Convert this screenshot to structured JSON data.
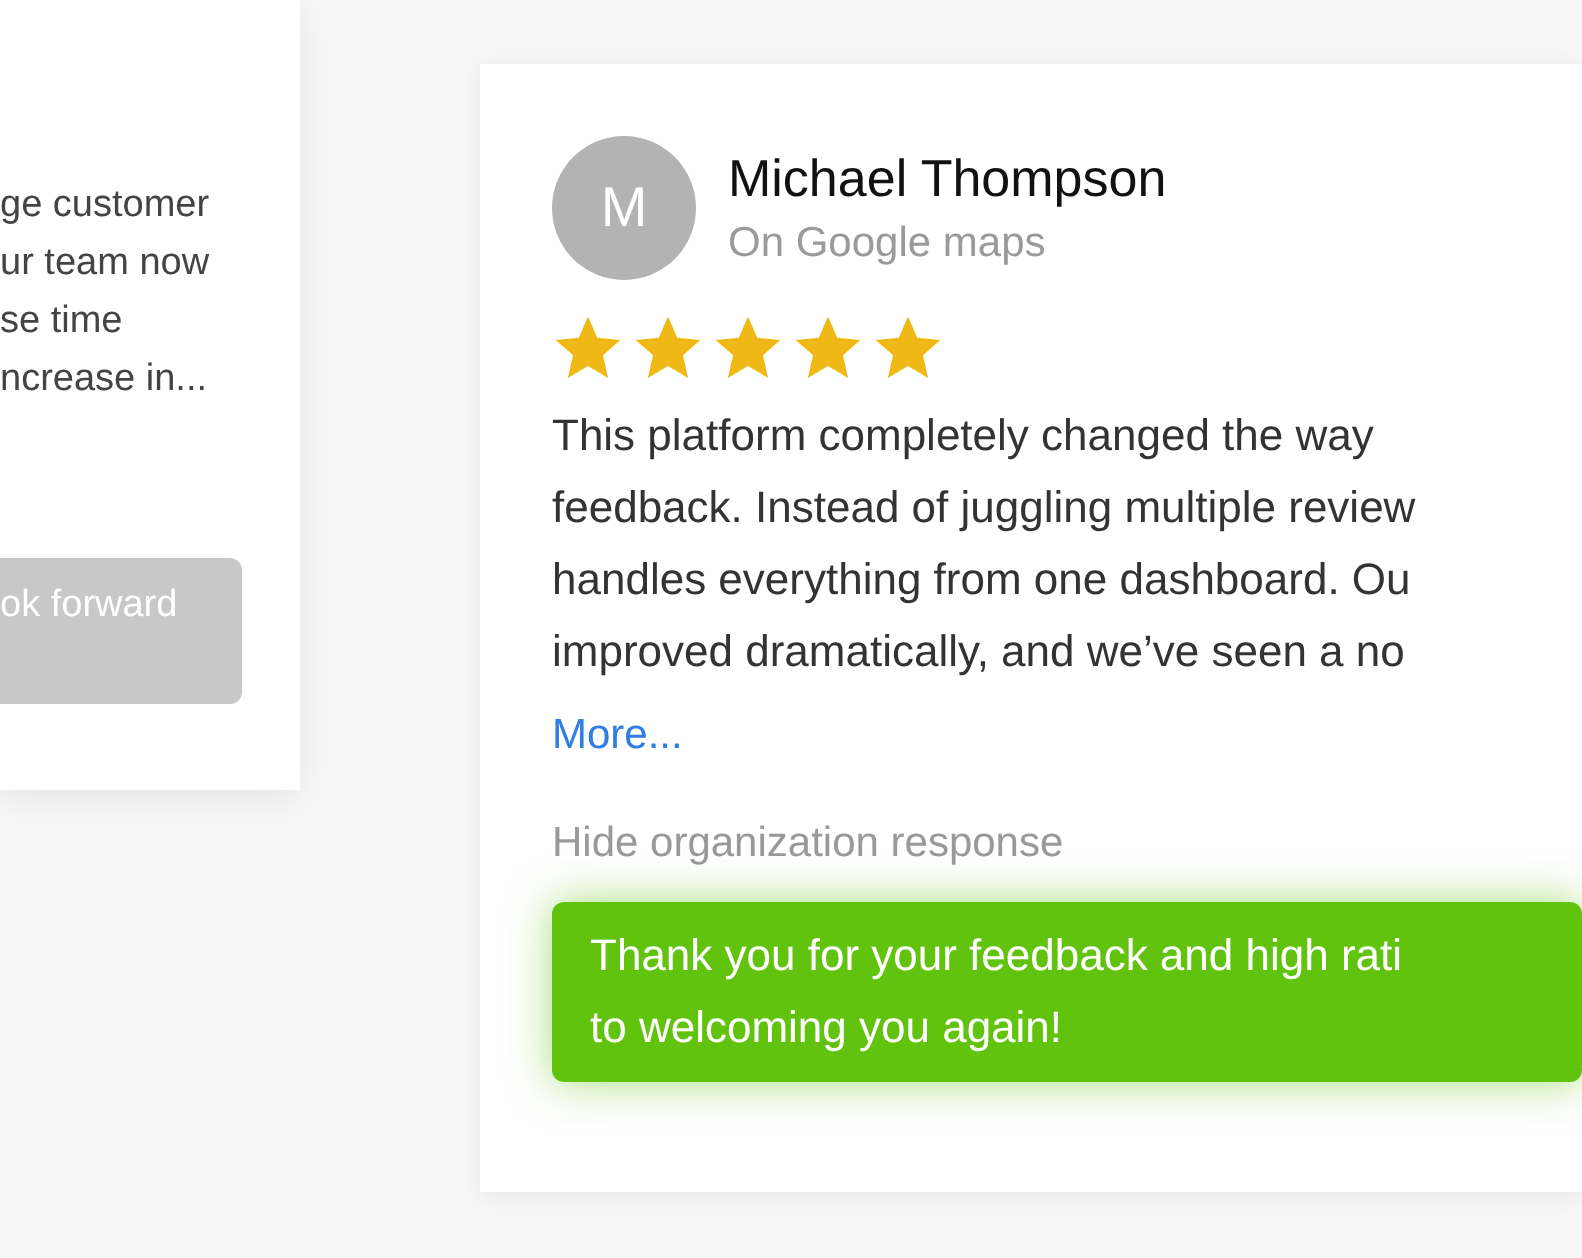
{
  "left_card": {
    "text_lines": [
      "ge customer",
      "ur team now",
      "se time",
      "ncrease in..."
    ],
    "response": {
      "text": "ok forward"
    }
  },
  "review_card": {
    "avatar": "M",
    "name": "Michael Thompson",
    "source": "On Google maps",
    "stars": 5,
    "text_lines": [
      "This platform completely changed the way",
      "feedback. Instead of juggling multiple review",
      "handles everything from one dashboard. Ou",
      "improved dramatically, and we’ve seen a no"
    ],
    "more_link": "More...",
    "toggle": "Hide organization response",
    "response": {
      "lines": [
        "Thank you for your feedback and high rati",
        "to welcoming you again!"
      ]
    }
  }
}
